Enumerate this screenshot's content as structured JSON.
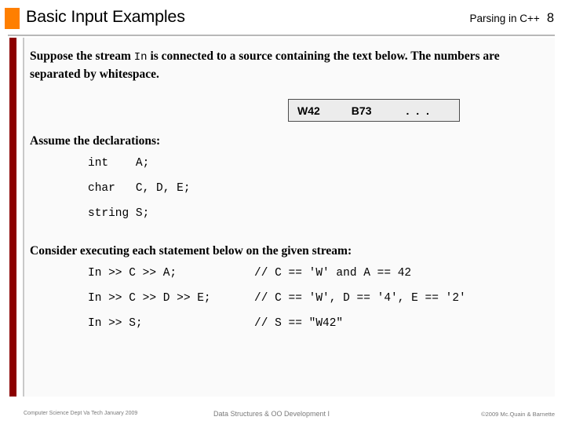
{
  "header": {
    "title": "Basic Input Examples",
    "subtitle": "Parsing in C++",
    "page_number": "8",
    "accent_color": "#ff7f00",
    "rule_color": "#b8b8b8"
  },
  "sidebar": {
    "bar_color": "#8b0000"
  },
  "content": {
    "background": "#fafafa",
    "intro": {
      "before_code": "Suppose the stream ",
      "code": "In",
      "after_code": " is connected to a source containing the text below.  The numbers are separated by whitespace."
    },
    "stream_box": {
      "token_1": "W42",
      "token_2": "B73",
      "ellipsis": ". . .",
      "fill": "#ececec",
      "border": "#4d4d4d"
    },
    "declarations_label": "Assume the declarations:",
    "declarations": [
      "int    A;",
      "char   C, D, E;",
      "string S;"
    ],
    "consider_label": "Consider executing each statement below on the given stream:",
    "statements": [
      {
        "code": "In >> C >> A;",
        "comment": "// C == 'W' and A == 42"
      },
      {
        "code": "In >> C >> D >> E;",
        "comment": "// C == 'W', D == '4', E == '2'"
      },
      {
        "code": "In >> S;",
        "comment": "// S == \"W42\""
      }
    ]
  },
  "footer": {
    "left": "Computer Science Dept Va Tech January 2009",
    "center": "Data Structures & OO Development I",
    "right": "©2009 Mc.Quain & Barnette"
  }
}
